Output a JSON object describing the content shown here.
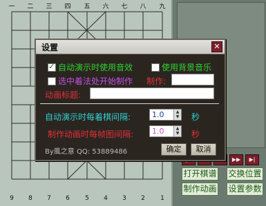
{
  "board": {
    "top_numbers": [
      "一",
      "二",
      "三",
      "四",
      "五",
      "六",
      "七",
      "八",
      "九"
    ],
    "bottom_numbers": [
      "9",
      "8",
      "7",
      "6",
      "5",
      "4",
      "3",
      "2",
      "1"
    ]
  },
  "nav_buttons": [
    "|◀",
    "◀◀",
    "▶",
    "▶▶",
    "▶|"
  ],
  "panel_buttons": {
    "open_record": "打开棋谱",
    "swap_position": "交换位置",
    "make_animation": "制作动画",
    "set_params": "设置参数"
  },
  "dialog": {
    "title": "设置",
    "close": "✕",
    "auto_sound_label": "自动演示时使用音效",
    "auto_sound_checked": true,
    "bg_music_label": "使用背景音乐",
    "bg_music_checked": false,
    "select_start_label": "选中着法处开始制作",
    "select_start_checked": false,
    "maker_label": "制作:",
    "maker_value": "",
    "anim_title_label": "动画标题:",
    "anim_title_value": "",
    "interval_move_label": "自动演示时每着棋间隔:",
    "interval_move_value": "1.0",
    "interval_move_unit": "秒",
    "interval_frame_label": "制作动画时每帧图间隔:",
    "interval_frame_value": "1.0",
    "interval_frame_unit": "秒",
    "author": "By風之意 QQ: 53889486",
    "ok_button": "确定",
    "cancel_button": "取消"
  },
  "colors": {
    "cyan_text": "#2fd0d2",
    "green_text": "#2fd12f",
    "magenta_text": "#c050e0",
    "red_text": "#e0303a",
    "gray_text": "#bcbcbc"
  }
}
